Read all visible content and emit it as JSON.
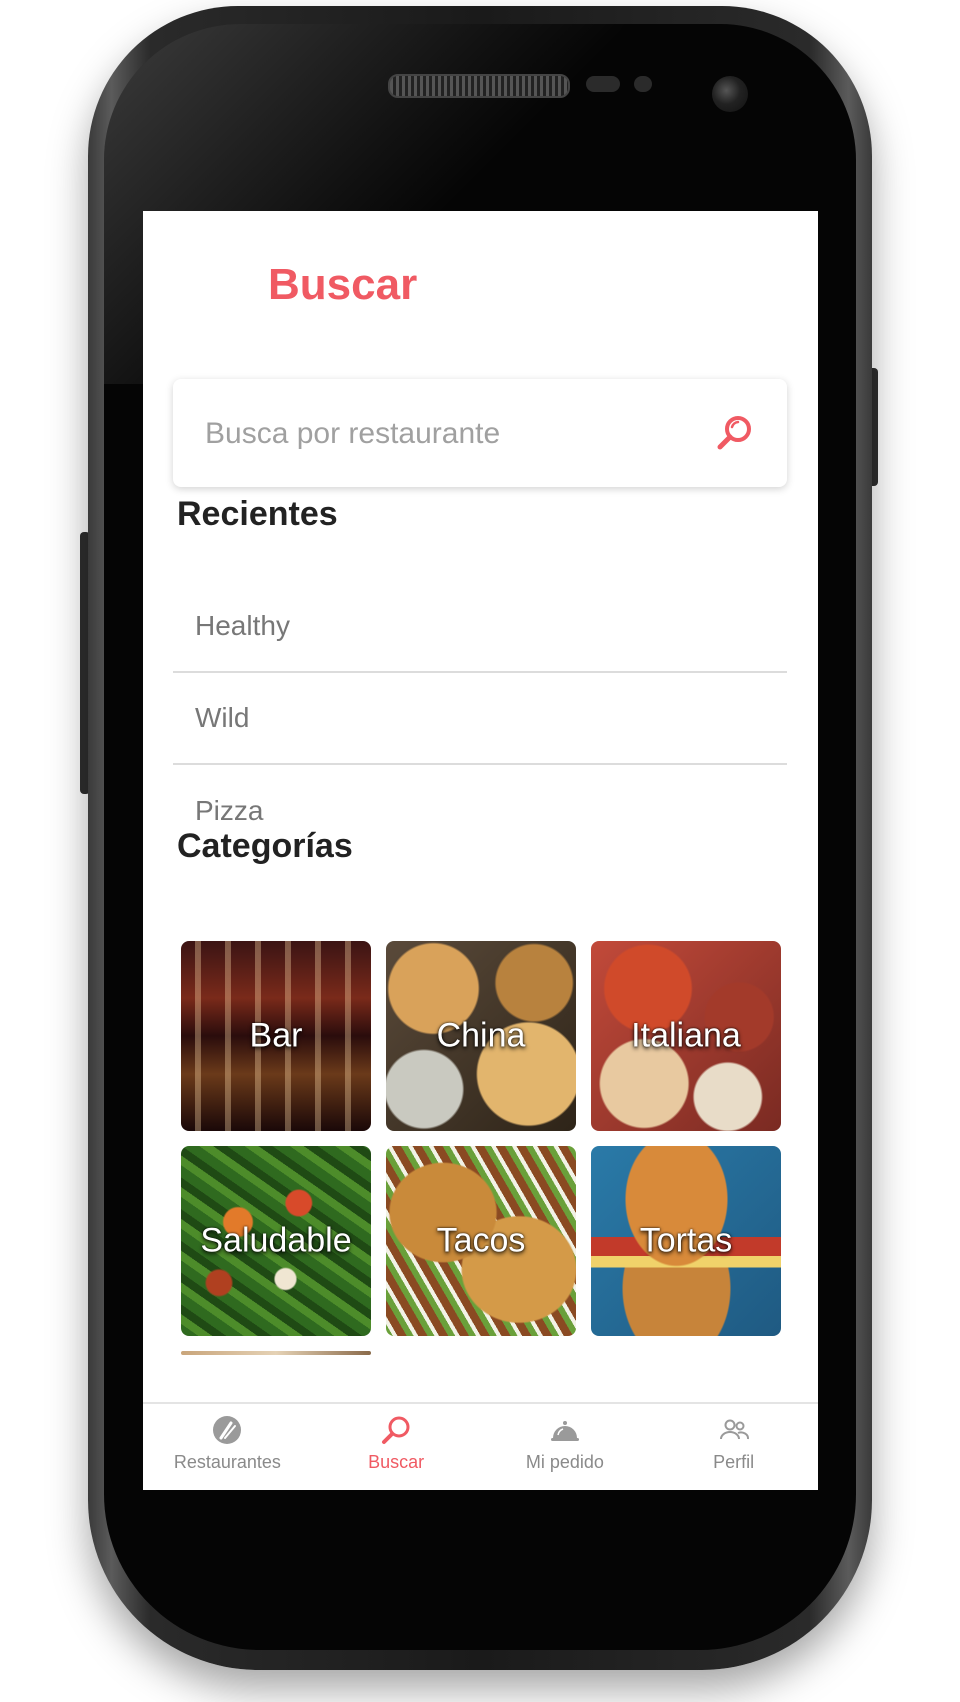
{
  "page": {
    "title": "Buscar"
  },
  "search": {
    "placeholder": "Busca por restaurante",
    "value": ""
  },
  "recent": {
    "heading": "Recientes",
    "items": [
      {
        "label": "Healthy"
      },
      {
        "label": "Wild"
      },
      {
        "label": "Pizza"
      }
    ]
  },
  "categories": {
    "heading": "Categorías",
    "items": [
      {
        "label": "Bar",
        "icon": "bar-image"
      },
      {
        "label": "China",
        "icon": "china-image"
      },
      {
        "label": "Italiana",
        "icon": "italiana-image"
      },
      {
        "label": "Saludable",
        "icon": "saludable-image"
      },
      {
        "label": "Tacos",
        "icon": "tacos-image"
      },
      {
        "label": "Tortas",
        "icon": "tortas-image"
      }
    ]
  },
  "nav": {
    "active": "Buscar",
    "items": [
      {
        "label": "Restaurantes",
        "icon": "restaurant-icon"
      },
      {
        "label": "Buscar",
        "icon": "search-icon"
      },
      {
        "label": "Mi pedido",
        "icon": "cloche-icon"
      },
      {
        "label": "Perfil",
        "icon": "profile-icon"
      }
    ]
  },
  "colors": {
    "accent": "#f05a63",
    "muted": "#8a8a8a",
    "text": "#222222"
  }
}
